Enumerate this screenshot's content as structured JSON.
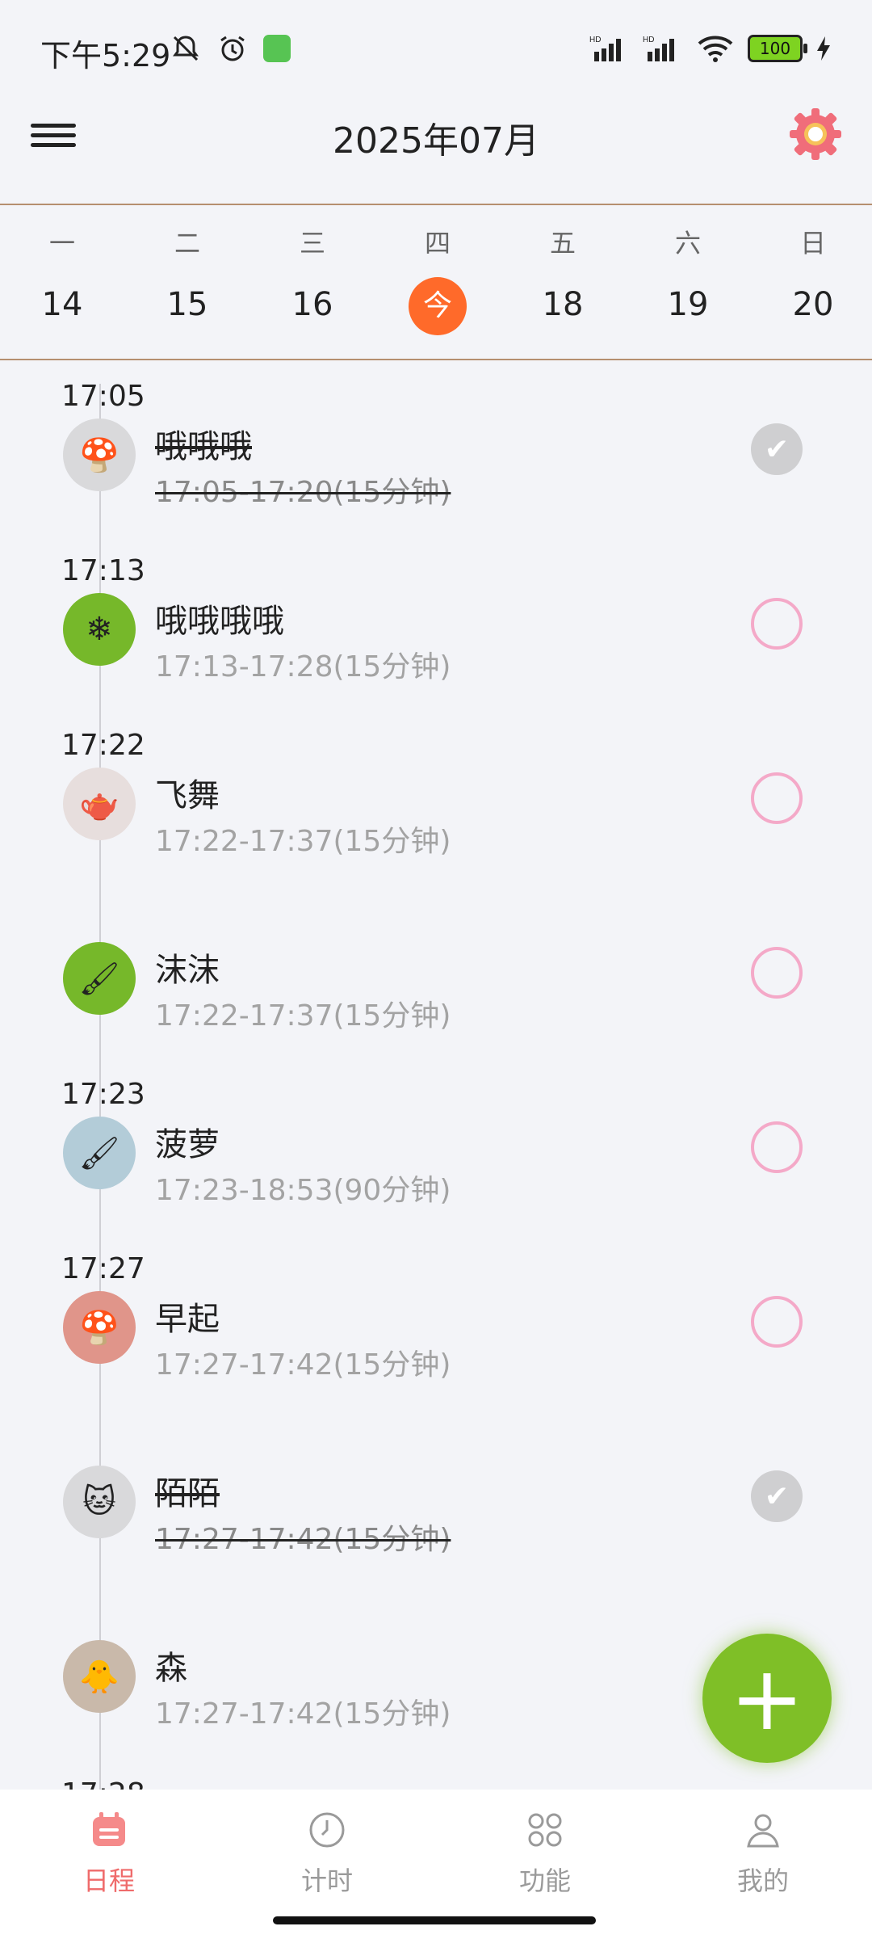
{
  "status": {
    "time": "下午5:29",
    "battery": "100",
    "icons_left": [
      "muted-bell-icon",
      "alarm-icon",
      "app-notification-icon"
    ],
    "icons_right": [
      "hd-signal-icon",
      "hd-signal-icon",
      "wifi-icon",
      "battery-icon",
      "charging-icon"
    ]
  },
  "header": {
    "title": "2025年07月",
    "menu_icon": "menu-icon",
    "settings_icon": "gear-icon"
  },
  "week": {
    "days": [
      "一",
      "二",
      "三",
      "四",
      "五",
      "六",
      "日"
    ],
    "dates": [
      "14",
      "15",
      "16",
      "今",
      "18",
      "19",
      "20"
    ],
    "today_index": 3,
    "today_color": "#ff6a2a"
  },
  "items": [
    {
      "time": "17:05",
      "title": "哦哦哦",
      "sub": "17:05-17:20(15分钟)",
      "done": true,
      "avatar_color": "#d9d9db",
      "avatar_icon": "mushroom-icon"
    },
    {
      "time": "17:13",
      "title": "哦哦哦哦",
      "sub": "17:13-17:28(15分钟)",
      "done": false,
      "avatar_color": "#76b82a",
      "avatar_icon": "snowflake-icon"
    },
    {
      "time": "17:22",
      "title": "飞舞",
      "sub": "17:22-17:37(15分钟)",
      "done": false,
      "avatar_color": "#e7dedd",
      "avatar_icon": "kettle-icon"
    },
    {
      "time": "",
      "title": "沫沫",
      "sub": "17:22-17:37(15分钟)",
      "done": false,
      "avatar_color": "#76b82a",
      "avatar_icon": "brushes-icon"
    },
    {
      "time": "17:23",
      "title": "菠萝",
      "sub": "17:23-18:53(90分钟)",
      "done": false,
      "avatar_color": "#b3ccd8",
      "avatar_icon": "brushes-icon"
    },
    {
      "time": "17:27",
      "title": "早起",
      "sub": "17:27-17:42(15分钟)",
      "done": false,
      "avatar_color": "#e0958a",
      "avatar_icon": "mushroom-icon"
    },
    {
      "time": "",
      "title": "陌陌",
      "sub": "17:27-17:42(15分钟)",
      "done": true,
      "avatar_color": "#d9d9db",
      "avatar_icon": "cat-icon"
    },
    {
      "time": "",
      "title": "森",
      "sub": "17:27-17:42(15分钟)",
      "done": false,
      "avatar_color": "#c9b9aa",
      "avatar_icon": "duck-icon"
    }
  ],
  "fab": {
    "label": "+",
    "color": "#7fbf27"
  },
  "tabs": [
    {
      "label": "日程",
      "icon": "calendar-icon",
      "active": true
    },
    {
      "label": "计时",
      "icon": "clock-icon",
      "active": false
    },
    {
      "label": "功能",
      "icon": "grid-icon",
      "active": false
    },
    {
      "label": "我的",
      "icon": "person-icon",
      "active": false
    }
  ],
  "colors": {
    "accent": "#ef6b6b",
    "check_border": "#f4a9c8",
    "divider": "#b58f6f"
  }
}
